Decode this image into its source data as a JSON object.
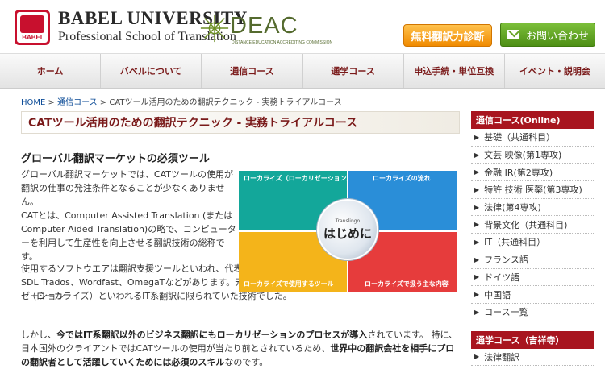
{
  "header": {
    "logo_small": "BABEL",
    "brand_title": "BABEL UNIVERSITY",
    "brand_sub": "Professional School of Translation",
    "deac": "DEAC",
    "deac_sub": "DISTANCE EDUCATION ACCREDITING COMMISSION",
    "diag_button": "無料翻訳力診断",
    "contact_button": "お問い合わせ"
  },
  "nav": [
    "ホーム",
    "バベルについて",
    "通信コース",
    "通学コース",
    "申込手続・単位互換",
    "イベント・説明会"
  ],
  "breadcrumb": {
    "home": "HOME",
    "sep1": " > ",
    "parent": "通信コース",
    "sep2": " > ",
    "current": "CATツール活用のための翻訳テクニック - 実務トライアルコース"
  },
  "page_title": "CATツール活用のための翻訳テクニック - 実務トライアルコース",
  "content": {
    "heading": "グローバル翻訳マーケットの必須ツール",
    "p1": "グローバル翻訳マーケットでは、CATツールの使用が翻訳の仕事の発注条件となることが少なくありません。",
    "p2": "CATとは、Computer Assisted Translation (またはComputer Aided Translation)の略で、コンピューターを利用して生産性を向上させる翻訳技術の総称です。",
    "p3": "使用するソフトウエアは翻訳支援ツールといわれ、代表的なものにSDL Trados、Wordfast、OmegaTなどがあります。元々ローカリゼーション",
    "p3b": "（ローカライズ）といわれるIT系翻訳に限られていた技術でした。",
    "p4_a": "しかし、",
    "p4_b": "今ではIT系翻訳以外のビジネス翻訳にもローカリゼーションのプロセスが導入",
    "p4_c": "されています。 特に、日本国外のクライアントではCATツールの使用が当たり前とされているため、",
    "p4_d": "世界中の翻訳会社を相手にプロの翻訳者として活躍していくためには必須のスキル",
    "p4_e": "なのです。"
  },
  "diagram": {
    "q1": "ローカライズ（ローカリゼーション）の定義",
    "q2": "ローカライズの流れ",
    "q3": "ローカライズで使用するツール",
    "q4": "ローカライズで扱う主な内容",
    "center_small": "Translingo",
    "center": "はじめに"
  },
  "sidebar": {
    "head1": "通信コース(Online)",
    "items1": [
      "基礎（共通科目）",
      "文芸 映像(第1専攻)",
      "金融 IR(第2専攻)",
      "特許 技術 医薬(第3専攻)",
      "法律(第4専攻)",
      "背景文化（共通科目)",
      "IT（共通科目）",
      "フランス語",
      "ドイツ語",
      "中国語",
      "コース一覧"
    ],
    "head2": "通学コース（吉祥寺）",
    "items2": [
      "法律翻訳"
    ]
  }
}
